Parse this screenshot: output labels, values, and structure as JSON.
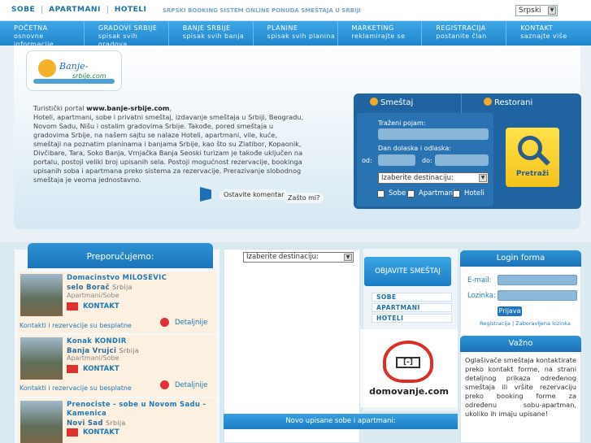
{
  "top": {
    "links": [
      "SOBE",
      "APARTMANI",
      "HOTELI"
    ],
    "tagline": "SRPSKI BOOKING SISTEM ONLINE PONUDA SMEŠTAJA U SRBIJI",
    "language": "Srpski"
  },
  "nav": [
    {
      "title": "POČETNA",
      "sub": "osnovne informacije"
    },
    {
      "title": "GRADOVI SRBIJE",
      "sub": "spisak svih gradova"
    },
    {
      "title": "BANJE SRBIJE",
      "sub": "spisak svih banja"
    },
    {
      "title": "PLANINE",
      "sub": "spisak svih planina"
    },
    {
      "title": "MARKETING",
      "sub": "reklamirajte se"
    },
    {
      "title": "REGISTRACIJA",
      "sub": "postanite član"
    },
    {
      "title": "KONTAKT",
      "sub": "saznajte više"
    }
  ],
  "logo": {
    "title": "Banje-",
    "sub": "srbije.com"
  },
  "intro": {
    "line1_pre": "Turistički portal ",
    "line1_b": "www.banje-srbije.com",
    "body": "Hoteli, apartmani, sobe i privatni smeštaj, izdavanje smeštaja u Srbiji, Beogradu, Novom Sadu, Nišu i ostalim gradovima Srbije. Takođe, pored smeštaja u gradovima Srbije, na našem sajtu se nalaze Hoteli, apartmani, vile, kuće, smeštaji na poznatim planinama i banjama Srbije, kao što su Zlatibor, Kopaonik, Divčibare, Tara, Soko Banja, Vrnjačka Banja Seoski turizam je takođe uključen na portalu, postoji veliki broj upisanih sela. Postoji mogućnost rezervacije, bookinga upisanih soba i apartmana preko sistema za rezervacije. Prerazivanje slobodnog smeštaja je veoma jednostavno."
  },
  "comment": {
    "leave": "Ostavite komentar",
    "why": "Zašto mi?"
  },
  "search": {
    "tab_lodging": "Smeštaj",
    "tab_restaurants": "Restorani",
    "term_label": "Traženi pojam:",
    "dates_label": "Dan dolaska i odlaska:",
    "from_label": "od:",
    "to_label": "do:",
    "destination": "Izaberite destinaciju:",
    "opt_rooms": "Sobe",
    "opt_apartments": "Apartmani",
    "opt_hotels": "Hoteli",
    "button": "Pretraži"
  },
  "recommended": {
    "header": "Preporučujemo:",
    "items": [
      {
        "name": "Domacinstvo MILOSEVIC",
        "place": "selo Borač",
        "country": "Srbija",
        "type": "Apartmani/Sobe",
        "contact": "KONTAKT",
        "footer": "Kontakti i rezervacije su besplatne",
        "details": "Detaljnije"
      },
      {
        "name": "Konak KONDIR",
        "place": "Banja Vrujci",
        "country": "Srbija",
        "type": "Apartmani/Sobe",
        "contact": "KONTAKT",
        "footer": "Kontakti i rezervacije su besplatne",
        "details": "Detaljnije"
      },
      {
        "name": "Prenociste - sobe u Novom Sadu - Kamenica",
        "place": "Novi Sad",
        "country": "Srbija",
        "type": "",
        "contact": "KONTAKT",
        "footer": "",
        "details": ""
      }
    ]
  },
  "middle": {
    "destination": "Izaberite destinaciju:",
    "publish": "OBJAVITE SMEŠTAJ",
    "sublinks": [
      "SOBE",
      "APARTMANI",
      "HOTELI"
    ],
    "partner": "domovanje.com",
    "new_listings": "Novo upisane sobe i apartmani:"
  },
  "login": {
    "header": "Login forma",
    "email": "E-mail:",
    "password": "Lozinka:",
    "button": "Prijava",
    "register": "Registracija",
    "sep": "|",
    "forgot": "Zaboravljena lozinka"
  },
  "important": {
    "header": "Važno",
    "text": "Oglašivače smeštaja kontaktirate preko kontakt forme, na strani detaljnog prikaza određenog smeštaja ili vršite rezervaciju preko booking forme za određenu sobu-apartman, ukoliko ih imaju upisane!"
  }
}
